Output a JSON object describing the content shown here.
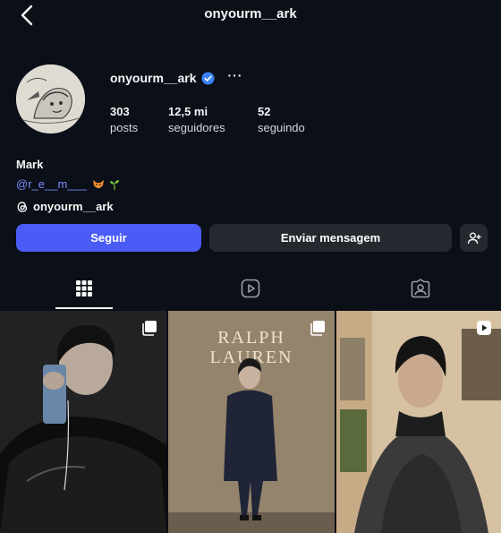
{
  "header": {
    "title": "onyourm__ark"
  },
  "profile": {
    "username": "onyourm__ark",
    "more_label": "···",
    "stats": [
      {
        "value": "303",
        "label": "posts"
      },
      {
        "value": "12,5 mi",
        "label": "seguidores"
      },
      {
        "value": "52",
        "label": "seguindo"
      }
    ],
    "name": "Mark",
    "bio_link": "@r_e__m___",
    "threads_handle": "onyourm__ark"
  },
  "actions": {
    "follow": "Seguir",
    "message": "Enviar mensagem"
  },
  "tabs": [
    {
      "icon": "grid-icon",
      "active": true
    },
    {
      "icon": "reels-icon",
      "active": false
    },
    {
      "icon": "tagged-icon",
      "active": false
    }
  ],
  "posts": [
    {
      "badge": "carousel-icon"
    },
    {
      "badge": "carousel-icon",
      "sign_text": "RALPH LAUREN"
    },
    {
      "badge": "reel-icon"
    }
  ],
  "colors": {
    "background": "#0b0f17",
    "accent": "#4a5cf5",
    "secondary_button": "#25292f",
    "link": "#7a8cff",
    "verified": "#3b82f6"
  }
}
